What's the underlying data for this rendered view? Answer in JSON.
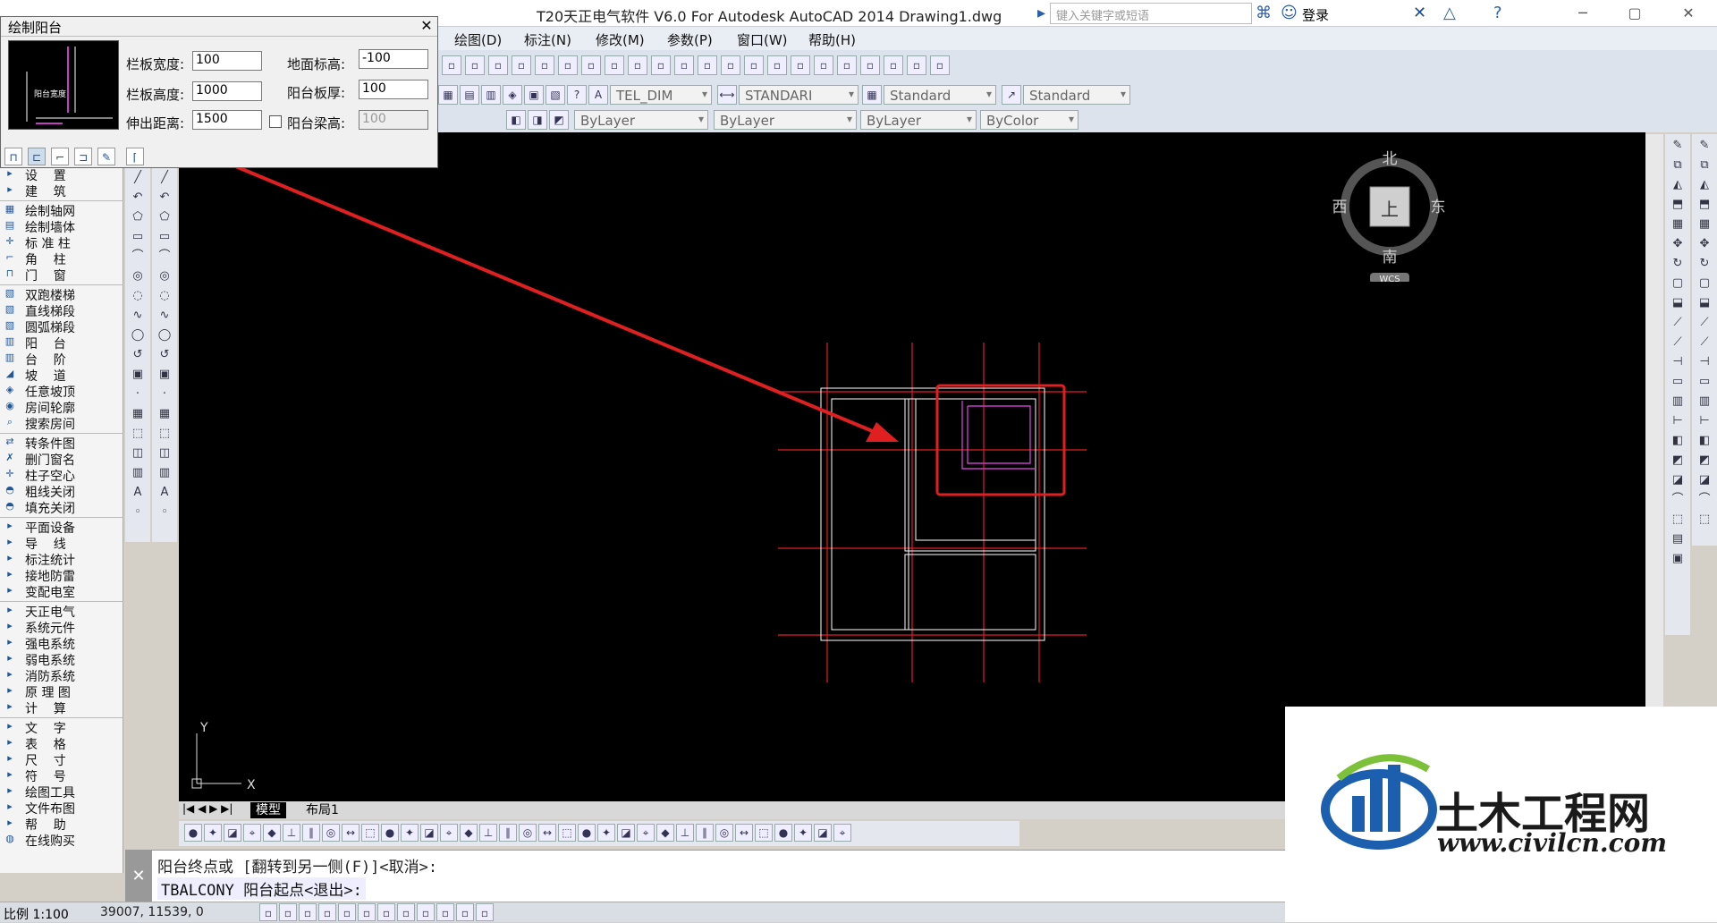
{
  "titlebar": {
    "title": "T20天正电气软件 V6.0 For Autodesk AutoCAD 2014    Drawing1.dwg",
    "search_placeholder": "键入关键字或短语",
    "login": "登录"
  },
  "menubar": {
    "items": [
      "绘图(D)",
      "标注(N)",
      "修改(M)",
      "参数(P)",
      "窗口(W)",
      "帮助(H)"
    ]
  },
  "toolbar": {
    "text_style": "TEL_DIM",
    "dim_style": "STANDARI",
    "table_style": "Standard",
    "mleader_style": "Standard",
    "layer_color": "ByLayer",
    "linetype": "ByLayer",
    "lineweight": "ByLayer",
    "plot_style": "ByColor"
  },
  "dialog": {
    "title": "绘制阳台",
    "preview_text": "阳台宽度",
    "fields": {
      "rail_width_label": "栏板宽度:",
      "rail_width": "100",
      "ground_elev_label": "地面标高:",
      "ground_elev": "-100",
      "rail_height_label": "栏板高度:",
      "rail_height": "1000",
      "slab_thick_label": "阳台板厚:",
      "slab_thick": "100",
      "extend_label": "伸出距离:",
      "extend": "1500",
      "beam_height_label": "阳台梁高:",
      "beam_height": "100"
    }
  },
  "left_panel": {
    "items": [
      {
        "label": "设    置",
        "icon": "arrow-icon"
      },
      {
        "label": "建    筑",
        "icon": "arrow-icon"
      },
      {
        "label": "绘制轴网",
        "icon": "grid-icon"
      },
      {
        "label": "绘制墙体",
        "icon": "wall-icon"
      },
      {
        "label": "标 准 柱",
        "icon": "column-icon"
      },
      {
        "label": "角    柱",
        "icon": "corner-icon"
      },
      {
        "label": "门    窗",
        "icon": "door-icon"
      },
      {
        "label": "双跑楼梯",
        "icon": "stair-icon"
      },
      {
        "label": "直线梯段",
        "icon": "stair-icon"
      },
      {
        "label": "圆弧梯段",
        "icon": "stair-icon"
      },
      {
        "label": "阳    台",
        "icon": "balcony-icon"
      },
      {
        "label": "台    阶",
        "icon": "step-icon"
      },
      {
        "label": "坡    道",
        "icon": "ramp-icon"
      },
      {
        "label": "任意坡顶",
        "icon": "roof-icon"
      },
      {
        "label": "房间轮廓",
        "icon": "room-icon"
      },
      {
        "label": "搜索房间",
        "icon": "search-icon"
      },
      {
        "label": "转条件图",
        "icon": "convert-icon"
      },
      {
        "label": "删门窗名",
        "icon": "delete-icon"
      },
      {
        "label": "柱子空心",
        "icon": "column-icon"
      },
      {
        "label": "粗线关闭",
        "icon": "bulb-icon"
      },
      {
        "label": "填充关闭",
        "icon": "bulb-icon"
      },
      {
        "label": "平面设备",
        "icon": "arrow-icon"
      },
      {
        "label": "导    线",
        "icon": "arrow-icon"
      },
      {
        "label": "标注统计",
        "icon": "arrow-icon"
      },
      {
        "label": "接地防雷",
        "icon": "arrow-icon"
      },
      {
        "label": "变配电室",
        "icon": "arrow-icon"
      },
      {
        "label": "天正电气",
        "icon": "arrow-icon"
      },
      {
        "label": "系统元件",
        "icon": "arrow-icon"
      },
      {
        "label": "强电系统",
        "icon": "arrow-icon"
      },
      {
        "label": "弱电系统",
        "icon": "arrow-icon"
      },
      {
        "label": "消防系统",
        "icon": "arrow-icon"
      },
      {
        "label": "原 理 图",
        "icon": "arrow-icon"
      },
      {
        "label": "计    算",
        "icon": "arrow-icon"
      },
      {
        "label": "文    字",
        "icon": "arrow-icon"
      },
      {
        "label": "表    格",
        "icon": "arrow-icon"
      },
      {
        "label": "尺    寸",
        "icon": "arrow-icon"
      },
      {
        "label": "符    号",
        "icon": "arrow-icon"
      },
      {
        "label": "绘图工具",
        "icon": "arrow-icon"
      },
      {
        "label": "文件布图",
        "icon": "arrow-icon"
      },
      {
        "label": "帮    助",
        "icon": "arrow-icon"
      },
      {
        "label": "在线购买",
        "icon": "cart-icon"
      }
    ]
  },
  "compass": {
    "north": "北",
    "south": "南",
    "east": "东",
    "west": "西",
    "top": "上",
    "wcs": "WCS"
  },
  "tabs": [
    "模型",
    "布局1"
  ],
  "command": {
    "line1": "阳台终点或 [翻转到另一侧(F)]<取消>:",
    "line2": "TBALCONY 阳台起点<退出>:"
  },
  "status": {
    "scale": "比例 1:100",
    "coords": "39007, 11539, 0"
  },
  "axis": {
    "x": "X",
    "y": "Y"
  },
  "watermark": {
    "brand": "土木工程网",
    "url": "www.civilcn.com"
  },
  "colors": {
    "accent": "#e02020",
    "canvas": "#000000",
    "magenta": "#c040c0"
  }
}
